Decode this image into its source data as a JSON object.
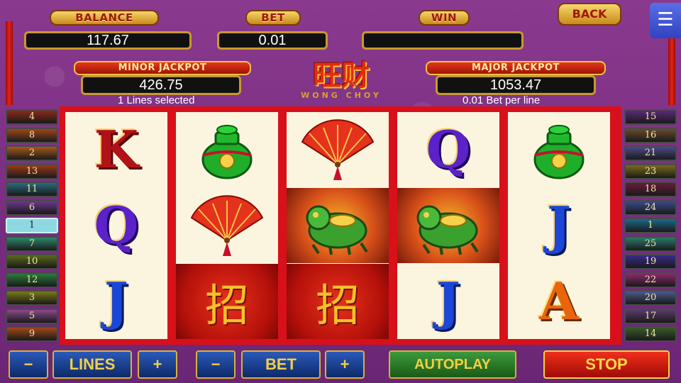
{
  "header": {
    "balance_label": "BALANCE",
    "balance_value": "117.67",
    "bet_label": "BET",
    "bet_value": "0.01",
    "win_label": "WIN",
    "win_value": "",
    "back_label": "BACK",
    "menu_icon": "hamburger-menu-icon"
  },
  "jackpots": {
    "minor_label": "MINOR JACKPOT",
    "minor_value": "426.75",
    "major_label": "MAJOR JACKPOT",
    "major_value": "1053.47"
  },
  "info": {
    "lines_selected": "1 Lines selected",
    "bet_per_line": "0.01 Bet per line"
  },
  "logo": {
    "main": "旺财",
    "sub": "WONG CHOY"
  },
  "left_lines": [
    {
      "label": "4",
      "color": "#8a2a1a"
    },
    {
      "label": "8",
      "color": "#a0461a"
    },
    {
      "label": "2",
      "color": "#a8581c"
    },
    {
      "label": "13",
      "color": "#9a3a1a"
    },
    {
      "label": "11",
      "color": "#2a6a7a"
    },
    {
      "label": "6",
      "color": "#6a3a8a"
    },
    {
      "label": "1",
      "color": "#8ed8e2",
      "active": true
    },
    {
      "label": "7",
      "color": "#2a8a6a"
    },
    {
      "label": "10",
      "color": "#5a6a1a"
    },
    {
      "label": "12",
      "color": "#2a7a3a"
    },
    {
      "label": "3",
      "color": "#7a7a1a"
    },
    {
      "label": "5",
      "color": "#8a4a8a"
    },
    {
      "label": "9",
      "color": "#a0461a"
    }
  ],
  "right_lines": [
    {
      "label": "15",
      "color": "#5a2a7a"
    },
    {
      "label": "16",
      "color": "#6a4a2a"
    },
    {
      "label": "21",
      "color": "#4a4a8a"
    },
    {
      "label": "23",
      "color": "#7a6a1a"
    },
    {
      "label": "18",
      "color": "#6a1a3a"
    },
    {
      "label": "24",
      "color": "#3a4a8a"
    },
    {
      "label": "1",
      "color": "#1a6a8a"
    },
    {
      "label": "25",
      "color": "#2a7a6a"
    },
    {
      "label": "19",
      "color": "#3a2a8a"
    },
    {
      "label": "22",
      "color": "#8a2a6a"
    },
    {
      "label": "20",
      "color": "#4a5a8a"
    },
    {
      "label": "17",
      "color": "#5a3a6a"
    },
    {
      "label": "14",
      "color": "#3a5a2a"
    }
  ],
  "reels": [
    [
      {
        "symbol": "K",
        "kind": "sym-k"
      },
      {
        "symbol": "Q",
        "kind": "sym-q"
      },
      {
        "symbol": "J",
        "kind": "sym-j"
      }
    ],
    [
      {
        "symbol": "vase",
        "kind": "vase"
      },
      {
        "symbol": "fan",
        "kind": "fan"
      },
      {
        "symbol": "招财进宝",
        "kind": "fortune"
      }
    ],
    [
      {
        "symbol": "fan",
        "kind": "fan"
      },
      {
        "symbol": "dragon",
        "kind": "dragon"
      },
      {
        "symbol": "招财进宝",
        "kind": "fortune"
      }
    ],
    [
      {
        "symbol": "Q",
        "kind": "sym-q"
      },
      {
        "symbol": "dragon",
        "kind": "dragon"
      },
      {
        "symbol": "J",
        "kind": "sym-j"
      }
    ],
    [
      {
        "symbol": "vase",
        "kind": "vase"
      },
      {
        "symbol": "J",
        "kind": "sym-j"
      },
      {
        "symbol": "A",
        "kind": "sym-a"
      }
    ]
  ],
  "controls": {
    "lines_minus": "−",
    "lines_label": "LINES",
    "lines_plus": "+",
    "bet_minus": "−",
    "bet_label": "BET",
    "bet_plus": "+",
    "autoplay_label": "AUTOPLAY",
    "stop_label": "STOP"
  }
}
